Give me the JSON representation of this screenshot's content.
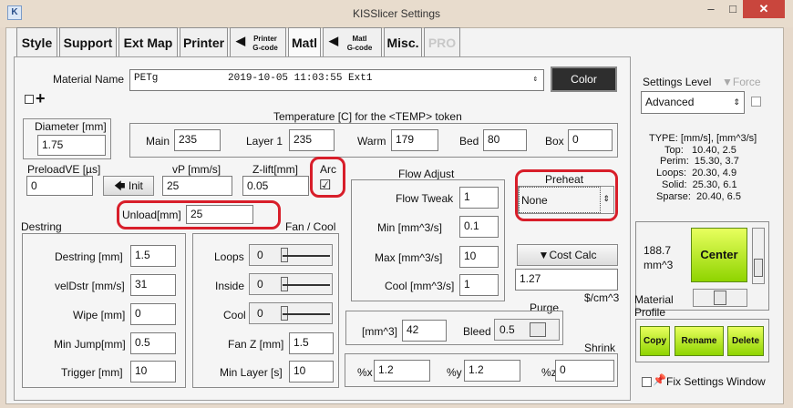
{
  "window": {
    "title": "KISSlicer Settings",
    "app_icon": "K",
    "minimize": "–",
    "maximize": "□",
    "close": "✕"
  },
  "tabs": {
    "style": "Style",
    "support": "Support",
    "ext_map": "Ext Map",
    "printer": "Printer",
    "printer_gcode_1": "Printer",
    "printer_gcode_2": "G-code",
    "matl": "Matl",
    "matl_gcode_1": "Matl",
    "matl_gcode_2": "G-code",
    "misc": "Misc.",
    "pro": "PRO"
  },
  "material": {
    "name_label": "Material Name",
    "name_type": "PETg",
    "name_rest": "2019-10-05 11:03:55 Ext1",
    "color_button": "Color",
    "add_icon": "+"
  },
  "diameter": {
    "label": "Diameter [mm]",
    "value": "1.75"
  },
  "temperature": {
    "label": "Temperature [C] for the <TEMP> token",
    "main_label": "Main",
    "main": "235",
    "layer1_label": "Layer 1",
    "layer1": "235",
    "warm_label": "Warm",
    "warm": "179",
    "bed_label": "Bed",
    "bed": "80",
    "box_label": "Box",
    "box": "0"
  },
  "preload": {
    "label": "PreloadVE [µs]",
    "value": "0",
    "init_button": "Init"
  },
  "vp": {
    "label": "vP [mm/s]",
    "value": "25"
  },
  "zlift": {
    "label": "Z-lift[mm]",
    "value": "0.05"
  },
  "arc": {
    "label": "Arc",
    "checked": "☑"
  },
  "unload": {
    "label": "Unload[mm]",
    "value": "25"
  },
  "destring": {
    "section_label": "Destring",
    "destring_label": "Destring [mm]",
    "destring": "1.5",
    "veldstr_label": "velDstr [mm/s]",
    "veldstr": "31",
    "wipe_label": "Wipe [mm]",
    "wipe": "0",
    "minjump_label": "Min Jump[mm]",
    "minjump": "0.5",
    "trigger_label": "Trigger [mm]",
    "trigger": "10"
  },
  "fan": {
    "section_label": "Fan / Cool",
    "loops_label": "Loops",
    "loops": "0",
    "inside_label": "Inside",
    "inside": "0",
    "cool_label": "Cool",
    "cool": "0",
    "fanz_label": "Fan Z [mm]",
    "fanz": "1.5",
    "minlayer_label": "Min Layer [s]",
    "minlayer": "10"
  },
  "flow": {
    "section_label": "Flow Adjust",
    "tweak_label": "Flow Tweak",
    "tweak": "1",
    "min_label": "Min [mm^3/s]",
    "min": "0.1",
    "max_label": "Max [mm^3/s]",
    "max": "10",
    "cool_label": "Cool [mm^3/s]",
    "cool": "1"
  },
  "preheat": {
    "label": "Preheat",
    "value": "None"
  },
  "cost": {
    "button": "Cost Calc",
    "value": "1.27",
    "unit": "$/cm^3"
  },
  "purge": {
    "label": "Purge",
    "volume_label": "[mm^3]",
    "volume": "42",
    "bleed_label": "Bleed",
    "bleed": "0.5"
  },
  "shrink": {
    "label": "Shrink",
    "x_label": "%x",
    "x": "1.2",
    "y_label": "%y",
    "y": "1.2",
    "z_label": "%z",
    "z": "0"
  },
  "sidebar": {
    "level_label": "Settings Level",
    "force_label": "Force",
    "level": "Advanced",
    "type_line": "TYPE: [mm/s], [mm^3/s]",
    "stats": [
      "Top:   10.40, 2.5",
      "Perim:  15.30, 3.7",
      "Loops:  20.30, 4.9",
      "Solid:  25.30, 6.1",
      "Sparse:  20.40, 6.5"
    ],
    "volume": "188.7",
    "volume_unit": "mm^3",
    "center_button": "Center",
    "material_profile_1": "Material",
    "material_profile_2": "Profile",
    "copy": "Copy",
    "rename": "Rename",
    "delete": "Delete",
    "fix_label": "Fix Settings Window"
  },
  "colors": {
    "green_button": "#b5e61d",
    "highlight": "#d81e2a"
  }
}
